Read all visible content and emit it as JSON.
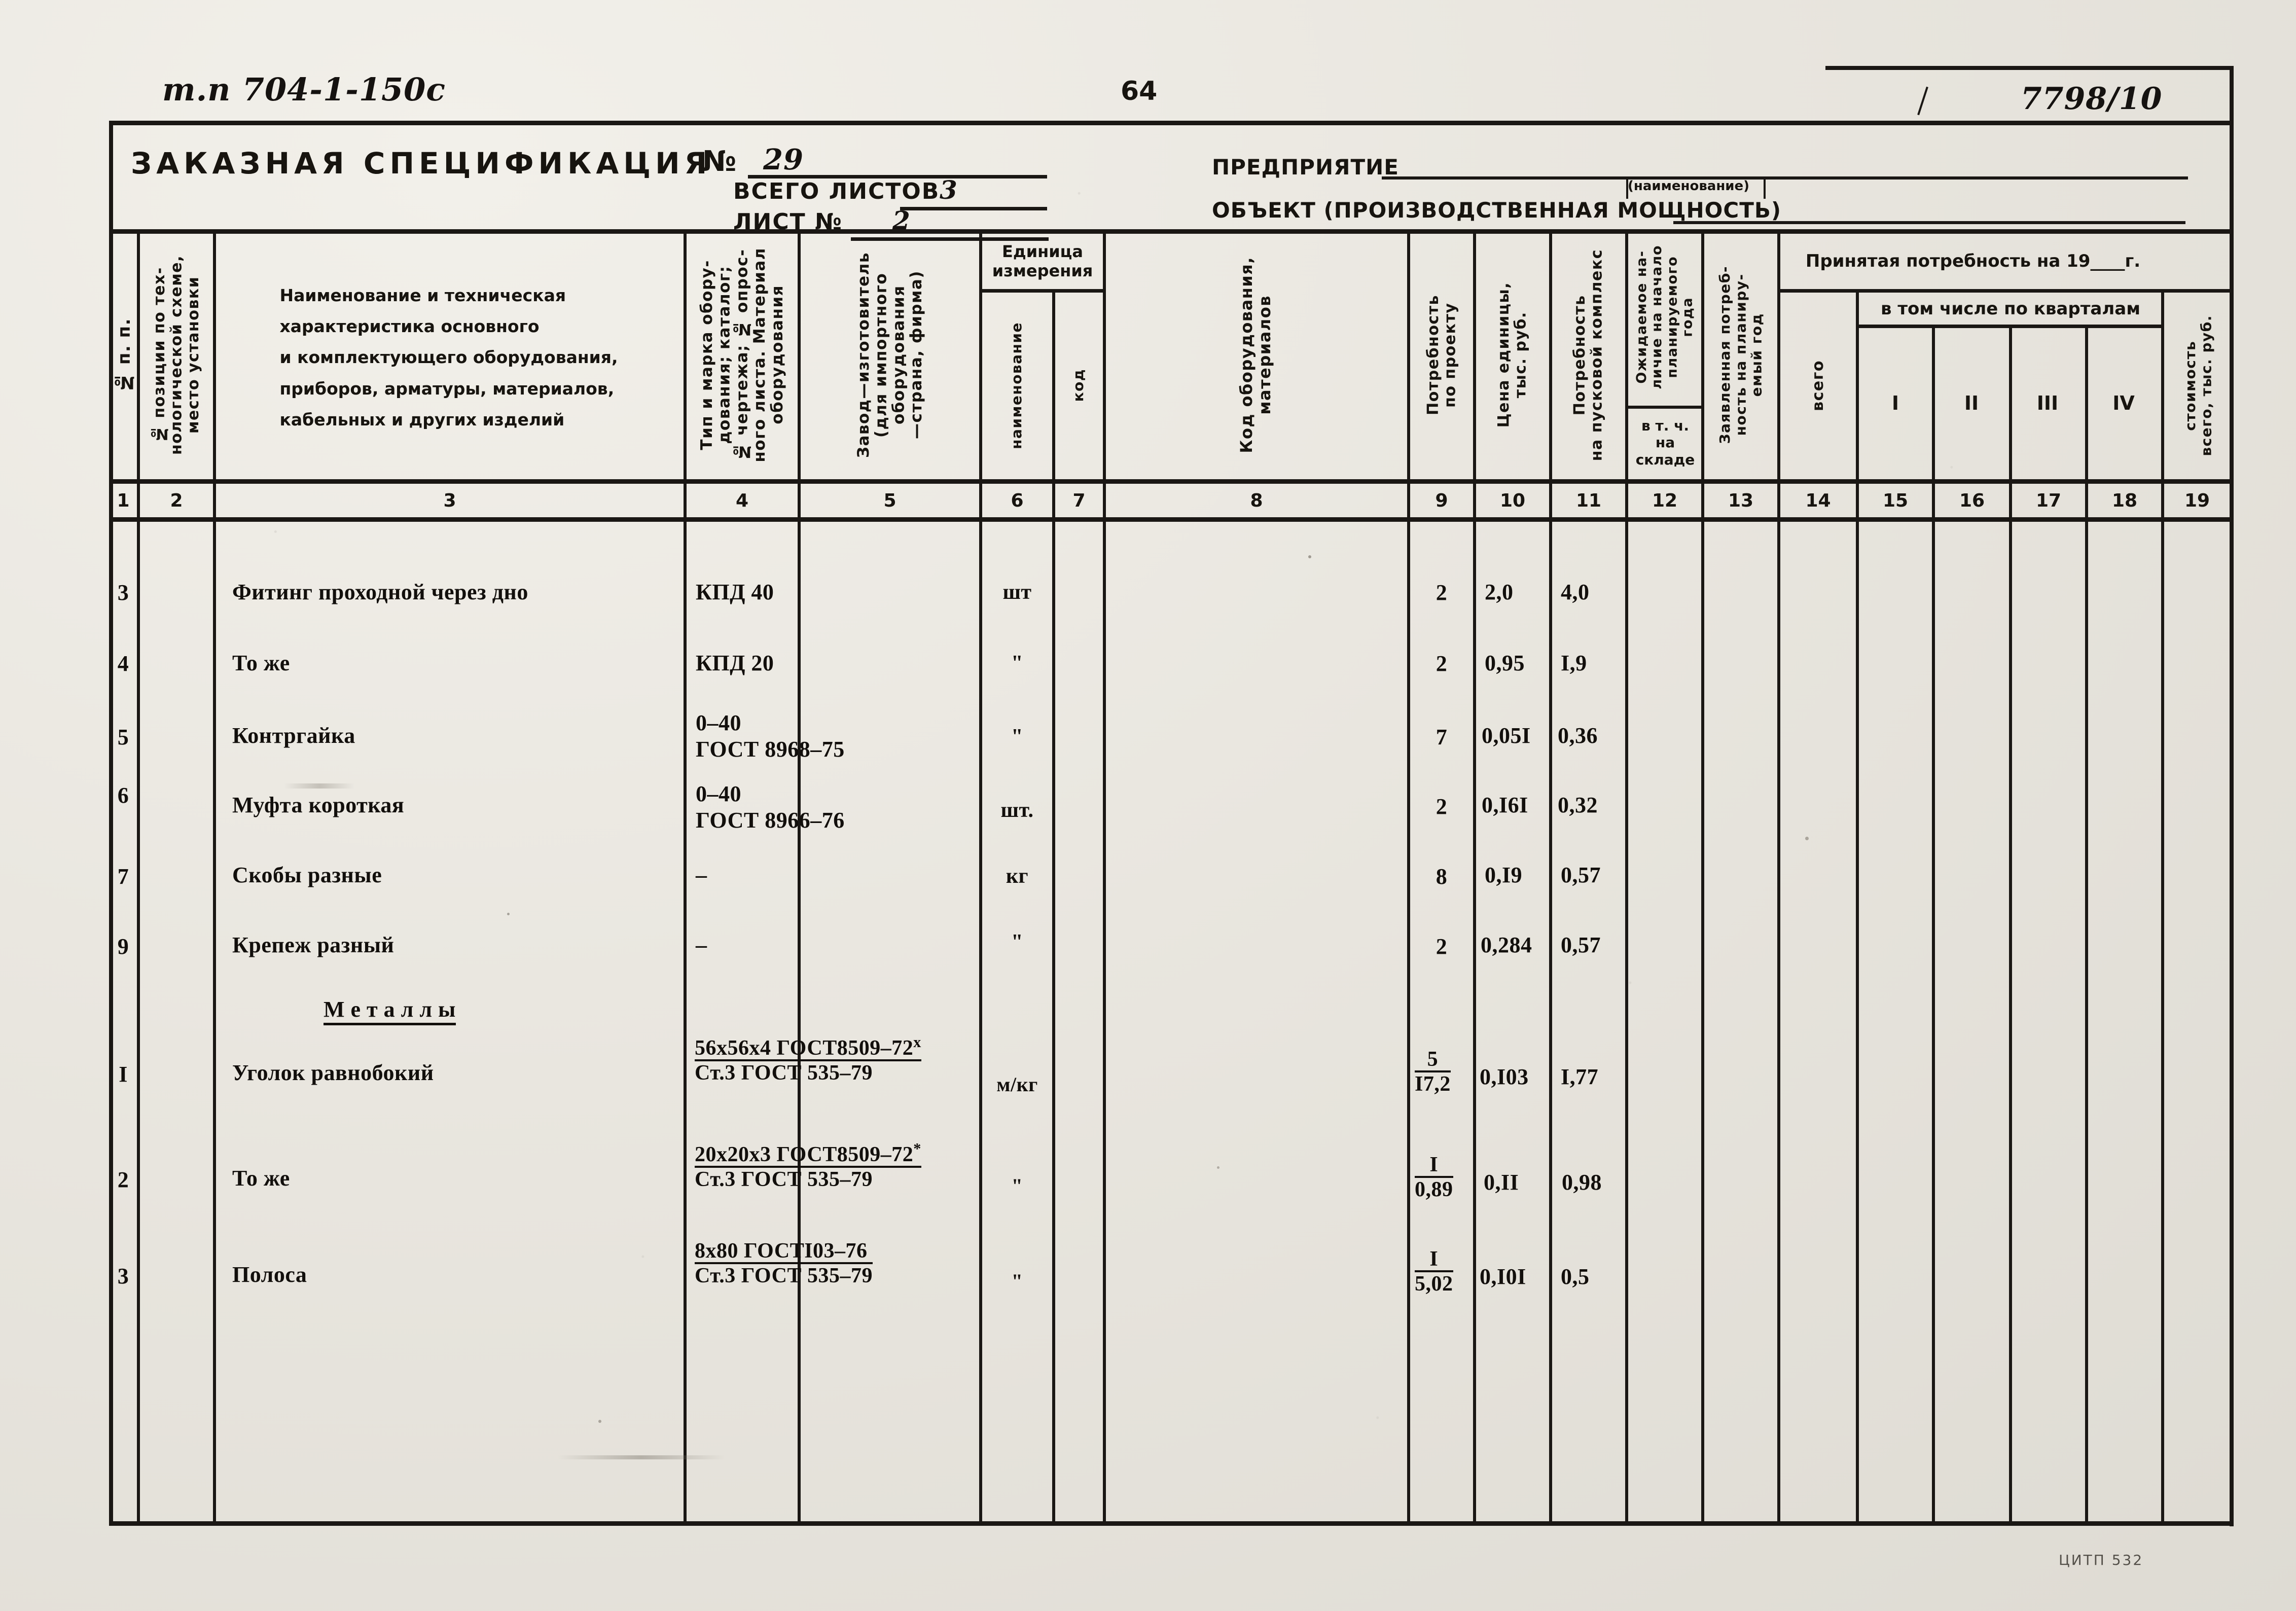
{
  "document": {
    "project_code": "т.п 704-1-150с",
    "page_number": "64",
    "archive_number": "7798/10",
    "footer_note": "ЦИТП   532"
  },
  "header": {
    "title": "ЗАКАЗНАЯ СПЕЦИФИКАЦИЯ",
    "number_label": "№",
    "number_value": "29",
    "total_sheets_label": "ВСЕГО ЛИСТОВ",
    "total_sheets_value": "3",
    "sheet_no_label": "ЛИСТ №",
    "sheet_no_value": "2",
    "enterprise_label": "ПРЕДПРИЯТИЕ",
    "enterprise_value": "",
    "enterprise_hint": "(наименование)",
    "object_label": "ОБЪЕКТ (ПРОИЗВОДСТВЕННАЯ МОЩНОСТЬ)",
    "object_value": ""
  },
  "table": {
    "group_headers": {
      "unit_of_measure": "Единица\nизмерения",
      "accepted_demand": "Принятая потребность на 19____г.",
      "by_quarters": "в том числе по кварталам"
    },
    "columns": [
      {
        "num": "1",
        "caption": "№ п. п."
      },
      {
        "num": "2",
        "caption": "№ позиции по тех-\nнологической схеме,\nместо установки"
      },
      {
        "num": "3",
        "caption": "Наименование и техническая\nхарактеристика основного\nи комплектующего оборудования,\nприборов, арматуры, материалов,\nкабельных и других изделий"
      },
      {
        "num": "4",
        "caption": "Тип и марка обору-\nдования; каталог;\n№ чертежа; № опрос-\nного листа. Материал\nоборудования"
      },
      {
        "num": "5",
        "caption": "Завод—изготовитель\n(для импортного\nоборудования\n—страна, фирма)"
      },
      {
        "num": "6",
        "caption": "наименование"
      },
      {
        "num": "7",
        "caption": "код"
      },
      {
        "num": "8",
        "caption": "Код оборудования,\nматериалов"
      },
      {
        "num": "9",
        "caption": "Потребность\nпо проекту"
      },
      {
        "num": "10",
        "caption": "Цена единицы,\nтыс. руб."
      },
      {
        "num": "11",
        "caption": "Потребность\nна пусковой комплекс"
      },
      {
        "num": "12",
        "caption": "Ожидаемое на-\nличие на начало\nпланируемого\nгода",
        "sub": "в т. ч.\nна\nскладе"
      },
      {
        "num": "13",
        "caption": "Заявленная потреб-\nность на планиру-\nемый год"
      },
      {
        "num": "14",
        "caption": "всего"
      },
      {
        "num": "15",
        "caption": "I"
      },
      {
        "num": "16",
        "caption": "II"
      },
      {
        "num": "17",
        "caption": "III"
      },
      {
        "num": "18",
        "caption": "IV"
      },
      {
        "num": "19",
        "caption": "стоимость\nвсего, тыс. руб."
      }
    ],
    "section_title": "М е т а л л ы",
    "rows": [
      {
        "no": "3",
        "name": "Фитинг проходной через дно",
        "type_line1": "КПД 40",
        "type_line2": "",
        "unit": "шт",
        "demand": "2",
        "unit_price": "2,0",
        "startup_demand": "4,0"
      },
      {
        "no": "4",
        "name": "То же",
        "type_line1": "КПД 20",
        "type_line2": "",
        "unit": "\"",
        "demand": "2",
        "unit_price": "0,95",
        "startup_demand": "I,9"
      },
      {
        "no": "5",
        "name": "Контргайка",
        "type_line1": "0–40",
        "type_line2": "ГОСТ 8968–75",
        "unit": "\"",
        "demand": "7",
        "unit_price": "0,05I",
        "startup_demand": "0,36"
      },
      {
        "no": "6",
        "name": "Муфта короткая",
        "type_line1": "0–40",
        "type_line2": "ГОСТ 8966–76",
        "unit": "шт.",
        "demand": "2",
        "unit_price": "0,I6I",
        "startup_demand": "0,32"
      },
      {
        "no": "7",
        "name": "Скобы разные",
        "type_line1": "–",
        "type_line2": "",
        "unit": "кг",
        "demand": "8",
        "unit_price": "0,I9",
        "startup_demand": "0,57"
      },
      {
        "no": "9",
        "name": "Крепеж разный",
        "type_line1": "–",
        "type_line2": "",
        "unit": "\"",
        "demand": "2",
        "unit_price": "0,284",
        "startup_demand": "0,57"
      }
    ],
    "metal_rows": [
      {
        "no": "I",
        "name": "Уголок равнобокий",
        "type_num": "56х56х4  ГОСТ8509–72",
        "type_mark": "x",
        "type_den": "Ст.3 ГОСТ 535–79",
        "unit": "м/кг",
        "demand_num": "5",
        "demand_den": "I7,2",
        "unit_price": "0,I03",
        "startup_demand": "I,77"
      },
      {
        "no": "2",
        "name": "То же",
        "type_num": "20х20х3  ГОСТ8509–72",
        "type_mark": "*",
        "type_den": "Ст.3 ГОСТ 535–79",
        "unit": "\"",
        "demand_num": "I",
        "demand_den": "0,89",
        "unit_price": "0,II",
        "startup_demand": "0,98"
      },
      {
        "no": "3",
        "name": "Полоса",
        "type_num": "8х80 ГОСТI03–76",
        "type_mark": "",
        "type_den": "Ст.3 ГОСТ 535–79",
        "unit": "\"",
        "demand_num": "I",
        "demand_den": "5,02",
        "unit_price": "0,I0I",
        "startup_demand": "0,5"
      }
    ]
  }
}
